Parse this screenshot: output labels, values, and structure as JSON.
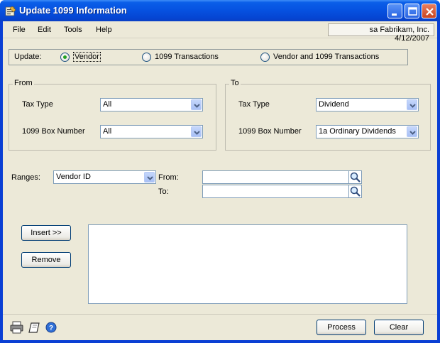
{
  "window": {
    "title": "Update 1099 Information"
  },
  "menu": {
    "items": [
      "File",
      "Edit",
      "Tools",
      "Help"
    ]
  },
  "company_info": "sa  Fabrikam, Inc.  4/12/2007",
  "update": {
    "label": "Update:",
    "options": [
      "Vendor",
      "1099 Transactions",
      "Vendor and 1099 Transactions"
    ],
    "selected": "Vendor"
  },
  "from": {
    "title": "From",
    "tax_type_label": "Tax Type",
    "tax_type_value": "All",
    "box_number_label": "1099 Box Number",
    "box_number_value": "All"
  },
  "to": {
    "title": "To",
    "tax_type_label": "Tax Type",
    "tax_type_value": "Dividend",
    "box_number_label": "1099 Box Number",
    "box_number_value": "1a Ordinary Dividends"
  },
  "ranges": {
    "label": "Ranges:",
    "value": "Vendor ID",
    "from_label": "From:",
    "to_label": "To:",
    "from_value": "",
    "to_value": ""
  },
  "buttons": {
    "insert": "Insert >>",
    "remove": "Remove",
    "process": "Process",
    "clear": "Clear"
  },
  "icons": [
    "printer-icon",
    "note-icon",
    "help-icon",
    "lookup-icon"
  ]
}
